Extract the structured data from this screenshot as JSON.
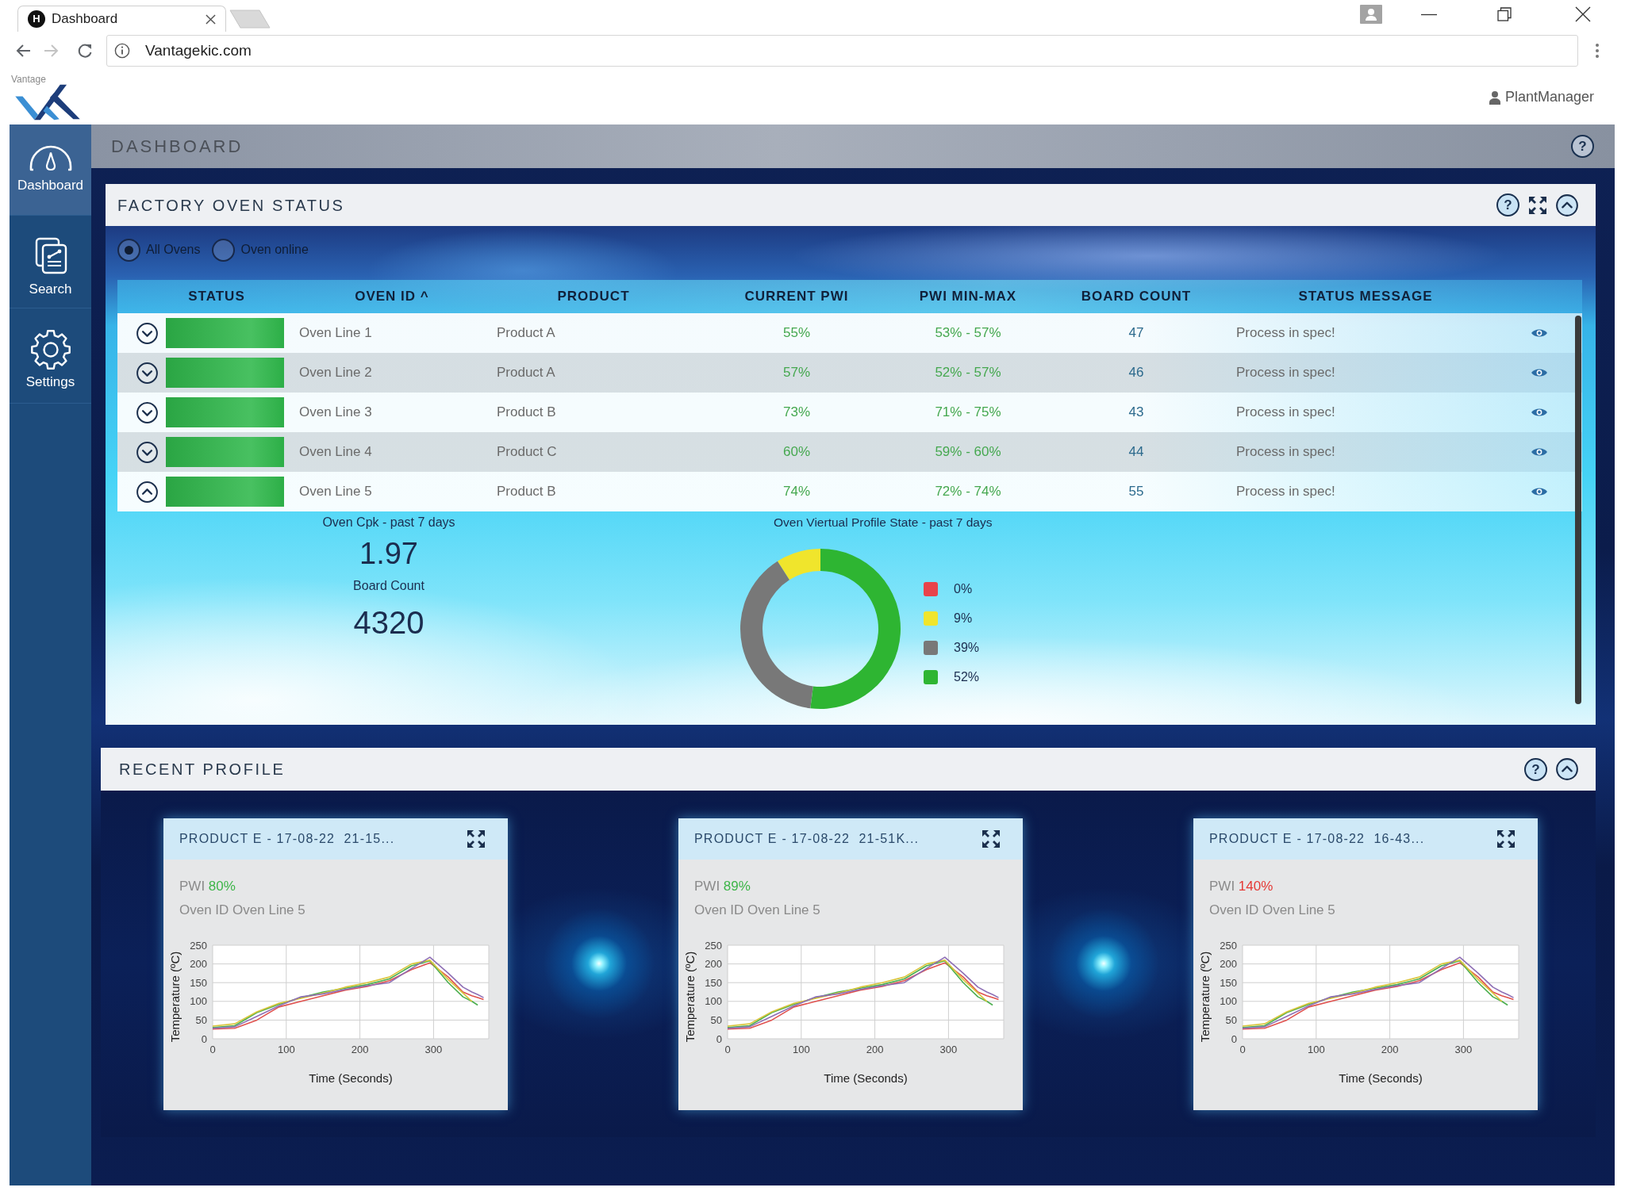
{
  "browser": {
    "tab": {
      "favicon": "H",
      "title": "Dashboard"
    },
    "nav": [
      {
        "kind": "back",
        "disabled": false
      },
      {
        "kind": "forward",
        "disabled": true
      },
      {
        "kind": "reload",
        "disabled": false
      }
    ],
    "address": "Vantagekic.com"
  },
  "app_header": {
    "logo_text": "Vantage",
    "user": "PlantManager"
  },
  "sidebar": {
    "items": [
      {
        "kind": "dashboard",
        "label": "Dashboard",
        "selected": true
      },
      {
        "kind": "search",
        "label": "Search",
        "selected": false
      },
      {
        "kind": "settings",
        "label": "Settings",
        "selected": false
      }
    ]
  },
  "page_header": {
    "title": "DASHBOARD",
    "help": "?"
  },
  "oven_status": {
    "title": "FACTORY OVEN STATUS",
    "help": "?",
    "filters": [
      {
        "label": "All Ovens",
        "selected": true
      },
      {
        "label": "Oven online",
        "selected": false
      }
    ],
    "table": {
      "columns": [
        "STATUS",
        "OVEN ID ^",
        "PRODUCT",
        "CURRENT PWI",
        "PWI MIN-MAX",
        "BOARD COUNT",
        "STATUS MESSAGE"
      ],
      "rows": [
        {
          "expanded": false,
          "color": "#2fb84b",
          "oven_id": "Oven Line 1",
          "product": "Product A",
          "current_pwi": "55%",
          "pwi_min_max": "53% - 57%",
          "board_count": "47",
          "status_message": "Process in spec!"
        },
        {
          "expanded": false,
          "color": "#2fb84b",
          "oven_id": "Oven Line 2",
          "product": "Product A",
          "current_pwi": "57%",
          "pwi_min_max": "52% - 57%",
          "board_count": "46",
          "status_message": "Process in spec!"
        },
        {
          "expanded": false,
          "color": "#2fb84b",
          "oven_id": "Oven Line 3",
          "product": "Product B",
          "current_pwi": "73%",
          "pwi_min_max": "71% - 75%",
          "board_count": "43",
          "status_message": "Process in spec!"
        },
        {
          "expanded": false,
          "color": "#2fb84b",
          "oven_id": "Oven Line 4",
          "product": "Product C",
          "current_pwi": "60%",
          "pwi_min_max": "59% - 60%",
          "board_count": "44",
          "status_message": "Process in spec!"
        },
        {
          "expanded": true,
          "color": "#2fb84b",
          "oven_id": "Oven Line 5",
          "product": "Product B",
          "current_pwi": "74%",
          "pwi_min_max": "72% - 74%",
          "board_count": "55",
          "status_message": "Process in spec!"
        }
      ]
    },
    "summary": {
      "cpk_label": "Oven Cpk - past 7 days",
      "cpk": "1.97",
      "board_count_label": "Board Count",
      "board_count": "4320"
    },
    "profile_state": {
      "legend": [
        {
          "label": "0%",
          "color": "#e8434a"
        },
        {
          "label": "9%",
          "color": "#f0e52c"
        },
        {
          "label": "39%",
          "color": "#787878"
        },
        {
          "label": "52%",
          "color": "#2eb532"
        }
      ],
      "chart_data": {
        "type": "donut",
        "title": "Oven Viertual Profile State - past 7 days",
        "values": [
          0,
          9,
          39,
          52
        ]
      }
    }
  },
  "recent_profile": {
    "title": "RECENT PROFILE",
    "help": "?",
    "cards": [
      {
        "title": "PRODUCT E - 17-08-22  21-15...",
        "pwi": {
          "label": "PWI",
          "value": "80%",
          "color": "#3db548"
        },
        "oven_id": "Oven ID Oven Line 5",
        "chart_data": {
          "type": "line",
          "grid": true,
          "xlabel": "Time (Seconds)",
          "ylabel": "Temperature (ºC)",
          "xlim": [
            0,
            375
          ],
          "ylim": [
            0,
            250
          ],
          "xticks": [
            0,
            100,
            200,
            300
          ],
          "yticks": [
            0,
            50,
            100,
            150,
            200,
            250
          ],
          "x": [
            0,
            30,
            60,
            90,
            120,
            150,
            180,
            210,
            240,
            270,
            295,
            320,
            340,
            352,
            360,
            368
          ],
          "series": [
            {
              "color": "#e0524f",
              "values": [
                26,
                28,
                50,
                85,
                100,
                115,
                130,
                140,
                155,
                185,
                203,
                165,
                125,
                115,
                110,
                105
              ]
            },
            {
              "color": "#4caf50",
              "values": [
                30,
                35,
                70,
                92,
                110,
                125,
                135,
                145,
                160,
                195,
                208,
                150,
                112,
                100,
                90,
                null
              ]
            },
            {
              "color": "#d9c53a",
              "values": [
                34,
                40,
                72,
                95,
                108,
                122,
                138,
                150,
                165,
                200,
                210,
                158,
                122,
                100,
                null,
                null
              ]
            },
            {
              "color": "#8e6fb5",
              "values": [
                28,
                32,
                60,
                88,
                112,
                120,
                132,
                142,
                150,
                188,
                218,
                175,
                138,
                125,
                118,
                110
              ]
            }
          ]
        }
      },
      {
        "title": "PRODUCT E - 17-08-22  21-51K...",
        "pwi": {
          "label": "PWI",
          "value": "89%",
          "color": "#3db548"
        },
        "oven_id": "Oven ID Oven Line 5",
        "chart_data": {
          "type": "line",
          "grid": true,
          "xlabel": "Time (Seconds)",
          "ylabel": "Temperature (ºC)",
          "xlim": [
            0,
            375
          ],
          "ylim": [
            0,
            250
          ],
          "xticks": [
            0,
            100,
            200,
            300
          ],
          "yticks": [
            0,
            50,
            100,
            150,
            200,
            250
          ],
          "x": [
            0,
            30,
            60,
            90,
            120,
            150,
            180,
            210,
            240,
            270,
            295,
            320,
            340,
            352,
            360,
            368
          ],
          "series": [
            {
              "color": "#e0524f",
              "values": [
                26,
                28,
                50,
                85,
                100,
                115,
                130,
                140,
                155,
                185,
                203,
                165,
                125,
                115,
                110,
                105
              ]
            },
            {
              "color": "#4caf50",
              "values": [
                30,
                35,
                70,
                92,
                110,
                125,
                135,
                145,
                160,
                195,
                208,
                150,
                112,
                100,
                90,
                null
              ]
            },
            {
              "color": "#d9c53a",
              "values": [
                34,
                40,
                72,
                95,
                108,
                122,
                138,
                150,
                165,
                200,
                210,
                158,
                122,
                100,
                null,
                null
              ]
            },
            {
              "color": "#8e6fb5",
              "values": [
                28,
                32,
                60,
                88,
                112,
                120,
                132,
                142,
                150,
                188,
                218,
                175,
                138,
                125,
                118,
                110
              ]
            }
          ]
        }
      },
      {
        "title": "PRODUCT E - 17-08-22  16-43...",
        "pwi": {
          "label": "PWI",
          "value": "140%",
          "color": "#e53935"
        },
        "oven_id": "Oven ID Oven Line 5",
        "chart_data": {
          "type": "line",
          "grid": true,
          "xlabel": "Time (Seconds)",
          "ylabel": "Temperature (ºC)",
          "xlim": [
            0,
            375
          ],
          "ylim": [
            0,
            250
          ],
          "xticks": [
            0,
            100,
            200,
            300
          ],
          "yticks": [
            0,
            50,
            100,
            150,
            200,
            250
          ],
          "x": [
            0,
            30,
            60,
            90,
            120,
            150,
            180,
            210,
            240,
            270,
            295,
            320,
            340,
            352,
            360,
            368
          ],
          "series": [
            {
              "color": "#e0524f",
              "values": [
                26,
                28,
                50,
                85,
                100,
                115,
                130,
                140,
                155,
                185,
                203,
                165,
                125,
                115,
                110,
                105
              ]
            },
            {
              "color": "#4caf50",
              "values": [
                30,
                35,
                70,
                92,
                110,
                125,
                135,
                145,
                160,
                195,
                208,
                150,
                112,
                100,
                90,
                null
              ]
            },
            {
              "color": "#d9c53a",
              "values": [
                34,
                40,
                72,
                95,
                108,
                122,
                138,
                150,
                165,
                200,
                210,
                158,
                122,
                100,
                null,
                null
              ]
            },
            {
              "color": "#8e6fb5",
              "values": [
                28,
                32,
                60,
                88,
                112,
                120,
                132,
                142,
                150,
                188,
                218,
                175,
                138,
                125,
                118,
                110
              ]
            }
          ]
        }
      }
    ]
  }
}
